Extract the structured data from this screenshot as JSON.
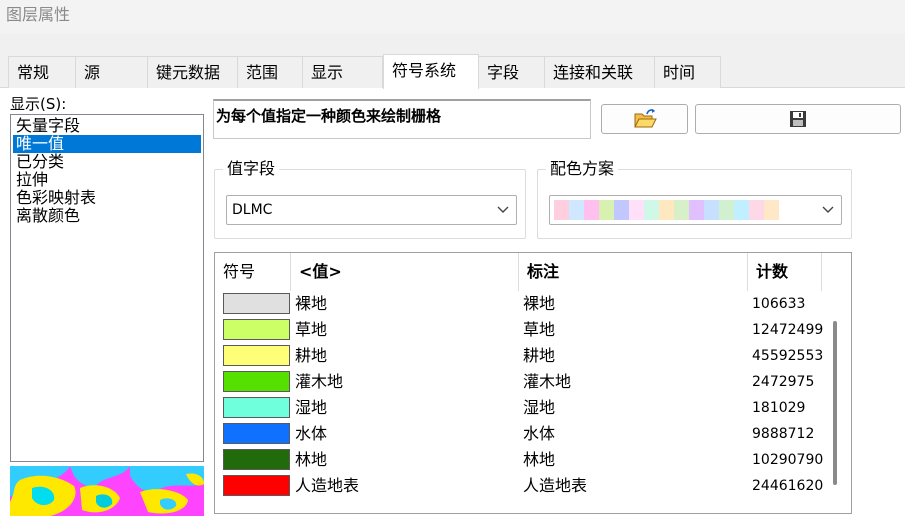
{
  "window": {
    "title": "图层属性"
  },
  "tabs": [
    {
      "label": "常规",
      "w": 68
    },
    {
      "label": "源",
      "w": 72
    },
    {
      "label": "键元数据",
      "w": 90
    },
    {
      "label": "范围",
      "w": 65
    },
    {
      "label": "显示",
      "w": 80
    },
    {
      "label": "符号系统",
      "w": 96,
      "active": true
    },
    {
      "label": "字段",
      "w": 66
    },
    {
      "label": "连接和关联",
      "w": 110
    },
    {
      "label": "时间",
      "w": 66
    }
  ],
  "show": {
    "label": "显示(S):",
    "items": [
      "矢量字段",
      "唯一值",
      "已分类",
      "拉伸",
      "色彩映射表",
      "离散颜色"
    ],
    "selected_index": 1
  },
  "description": "为每个值指定一种颜色来绘制栅格",
  "buttons": {
    "open_icon": "folder-open-icon",
    "save_icon": "floppy-save-icon"
  },
  "value_field": {
    "title": "值字段",
    "selected": "DLMC"
  },
  "color_scheme": {
    "title": "配色方案",
    "swatches": [
      "#ffcfe0",
      "#cfe8ff",
      "#ffc0f0",
      "#d8f0b0",
      "#c0c8ff",
      "#ffe0f8",
      "#d0f8e8",
      "#ffe8c0",
      "#d8f0c8",
      "#e0c0ff",
      "#c8e0ff",
      "#d0f0d0",
      "#c0f0ff",
      "#ffd8e8",
      "#ffe8c8"
    ]
  },
  "table": {
    "headers": {
      "symbol": "符号",
      "value": "<值>",
      "label": "标注",
      "count": "计数"
    },
    "rows": [
      {
        "color": "#e0e0e0",
        "value": "裸地",
        "label": "裸地",
        "count": "106633"
      },
      {
        "color": "#ccff66",
        "value": "草地",
        "label": "草地",
        "count": "12472499"
      },
      {
        "color": "#ffff77",
        "value": "耕地",
        "label": "耕地",
        "count": "45592553"
      },
      {
        "color": "#55e000",
        "value": "灌木地",
        "label": "灌木地",
        "count": "2472975"
      },
      {
        "color": "#6fffdc",
        "value": "湿地",
        "label": "湿地",
        "count": "181029"
      },
      {
        "color": "#1070ff",
        "value": "水体",
        "label": "水体",
        "count": "9888712"
      },
      {
        "color": "#226b0c",
        "value": "林地",
        "label": "林地",
        "count": "10290790"
      },
      {
        "color": "#ff0000",
        "value": "人造地表",
        "label": "人造地表",
        "count": "24461620"
      }
    ]
  }
}
